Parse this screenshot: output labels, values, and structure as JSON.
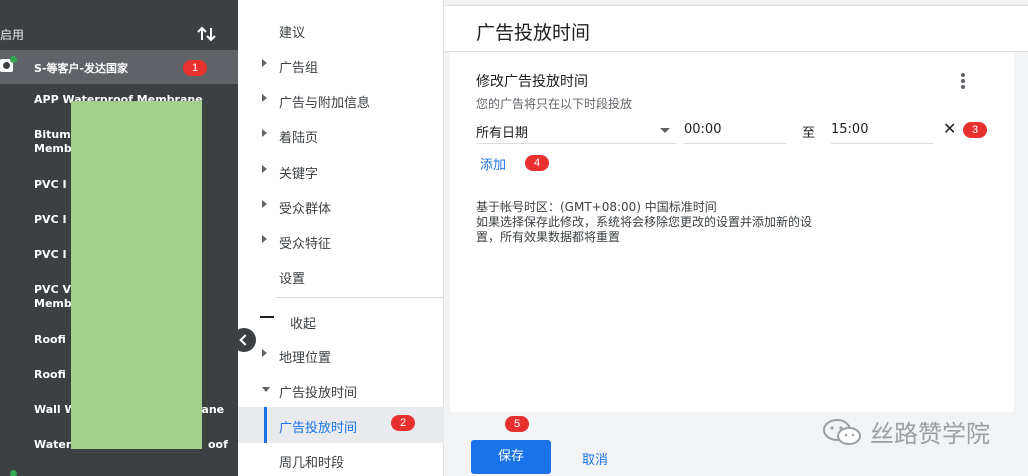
{
  "sidebar": {
    "status_label": "启用",
    "selected_campaign": "S-等客户-发达国家",
    "items": [
      "APP Waterproof Membrane",
      "Bitum",
      "Memb",
      "PVC I",
      "PVC I",
      "PVC I",
      "PVC V",
      "Memb",
      "Roofi",
      "Roofi",
      "Wall W",
      "rane",
      "Water",
      "oof"
    ]
  },
  "nav": {
    "suggestions": "建议",
    "ad_groups": "广告组",
    "ads_extensions": "广告与附加信息",
    "landing_pages": "着陆页",
    "keywords": "关键字",
    "audiences": "受众群体",
    "demographics": "受众特征",
    "settings": "设置",
    "collapse": "收起",
    "locations": "地理位置",
    "ad_schedule": "广告投放时间",
    "ad_schedule_active": "广告投放时间",
    "day_and_time": "周几和时段"
  },
  "main": {
    "page_title": "广告投放时间",
    "card_title": "修改广告投放时间",
    "card_subtitle": "您的广告将只在以下时段投放",
    "day_value": "所有日期",
    "start_time": "00:00",
    "to_label": "至",
    "end_time": "15:00",
    "remove_label": "✕",
    "add_label": "添加",
    "timezone_line": "基于帐号时区：(GMT+08:00) 中国标准时间",
    "warning_line1": "如果选择保存此修改，系统将会移除您更改的设置并添加新的设",
    "warning_line2": "置，所有效果数据都将重置",
    "save_label": "保存",
    "cancel_label": "取消"
  },
  "badges": [
    "1",
    "2",
    "3",
    "4",
    "5"
  ],
  "watermark": "丝路赞学院",
  "colors": {
    "accent": "#1a73e8",
    "sidebar": "#3c4043",
    "badge": "#e8312f"
  }
}
